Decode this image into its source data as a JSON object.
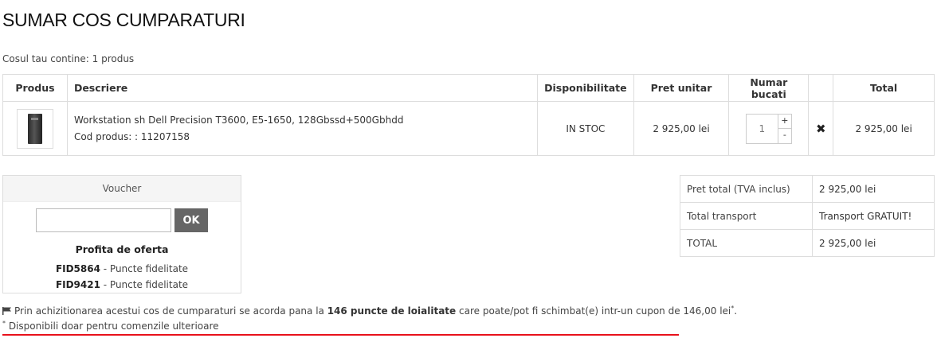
{
  "page": {
    "title": "SUMAR COS CUMPARATURI",
    "cart_count": "Cosul tau contine: 1 produs"
  },
  "cart_table": {
    "headers": {
      "product": "Produs",
      "description": "Descriere",
      "availability": "Disponibilitate",
      "unit_price": "Pret unitar",
      "quantity": "Numar bucati",
      "total": "Total"
    },
    "items": [
      {
        "image_icon": "workstation-tower-icon",
        "name": "Workstation sh Dell Precision T3600, E5-1650, 128Gbssd+500Gbhdd",
        "code": "Cod produs: : 11207158",
        "availability": "IN STOC",
        "unit_price": "2 925,00 lei",
        "quantity": "1",
        "plus": "+",
        "minus": "-",
        "remove": "✖",
        "total": "2 925,00 lei"
      }
    ]
  },
  "voucher": {
    "title": "Voucher",
    "input_value": "",
    "ok_label": "OK",
    "offer_title": "Profita de oferta",
    "offers": [
      {
        "code": "FID5864",
        "text": " - Puncte fidelitate"
      },
      {
        "code": "FID9421",
        "text": " - Puncte fidelitate"
      }
    ]
  },
  "totals": [
    {
      "label": "Pret total (TVA inclus)",
      "value": "2 925,00 lei"
    },
    {
      "label": "Total transport",
      "value": "Transport GRATUIT!"
    },
    {
      "label": "TOTAL",
      "value": "2 925,00 lei"
    }
  ],
  "loyalty": {
    "icon": "flag-icon",
    "text_before": "Prin achizitionarea acestui cos de cumparaturi se acorda pana la ",
    "points": "146 puncte de loialitate",
    "text_after": " care poate/pot fi schimbat(e) intr-un cupon de 146,00 lei",
    "asterisk": "*",
    "period": ".",
    "footnote_marker": "*",
    "footnote": " Disponibili doar pentru comenzile ulterioare"
  },
  "colors": {
    "ok_button": "#666666",
    "underline": "#e8111b"
  }
}
